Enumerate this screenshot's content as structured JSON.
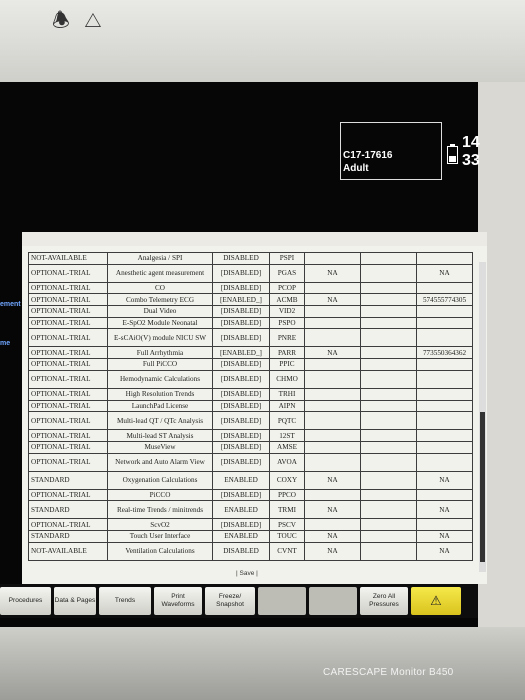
{
  "device": {
    "model": "CARESCAPE Monitor B450",
    "top_icons": [
      "alarm-audio-icon",
      "warning-triangle-icon"
    ]
  },
  "header": {
    "patient_id": "C17-17616",
    "patient_type": "Adult",
    "time": "14 33",
    "battery_level": 0.45
  },
  "side_labels": {
    "a": "ement",
    "b": "me"
  },
  "license_table": {
    "rows": [
      {
        "status": "NOT-AVAILABLE",
        "name": "Analgesia / SPI",
        "state": "DISABLED",
        "code": "PSPI",
        "s1": "",
        "s2": "",
        "s3": ""
      },
      {
        "status": "OPTIONAL-TRIAL",
        "name": "Anesthetic agent measurement",
        "state": "[DISABLED]",
        "code": "PGAS",
        "s1": "NA",
        "s2": "",
        "s3": "NA"
      },
      {
        "status": "OPTIONAL-TRIAL",
        "name": "CO",
        "state": "[DISABLED]",
        "code": "PCOP",
        "s1": "",
        "s2": "",
        "s3": ""
      },
      {
        "status": "OPTIONAL-TRIAL",
        "name": "Combo Telemetry ECG",
        "state": "[ENABLED_]",
        "code": "ACMB",
        "s1": "NA",
        "s2": "",
        "s3": "574555774305"
      },
      {
        "status": "OPTIONAL-TRIAL",
        "name": "Dual Video",
        "state": "[DISABLED]",
        "code": "VID2",
        "s1": "",
        "s2": "",
        "s3": ""
      },
      {
        "status": "OPTIONAL-TRIAL",
        "name": "E-SpO2 Module Neonatal",
        "state": "[DISABLED]",
        "code": "PSPO",
        "s1": "",
        "s2": "",
        "s3": ""
      },
      {
        "status": "OPTIONAL-TRIAL",
        "name": "E-sCAiO(V) module NICU SW",
        "state": "[DISABLED]",
        "code": "PNRE",
        "s1": "",
        "s2": "",
        "s3": ""
      },
      {
        "status": "OPTIONAL-TRIAL",
        "name": "Full Arrhythmia",
        "state": "[ENABLED_]",
        "code": "PARR",
        "s1": "NA",
        "s2": "",
        "s3": "773550364362"
      },
      {
        "status": "OPTIONAL-TRIAL",
        "name": "Full PiCCO",
        "state": "[DISABLED]",
        "code": "PPIC",
        "s1": "",
        "s2": "",
        "s3": ""
      },
      {
        "status": "OPTIONAL-TRIAL",
        "name": "Hemodynamic Calculations",
        "state": "[DISABLED]",
        "code": "CHMO",
        "s1": "",
        "s2": "",
        "s3": ""
      },
      {
        "status": "OPTIONAL-TRIAL",
        "name": "High Resolution Trends",
        "state": "[DISABLED]",
        "code": "TRHI",
        "s1": "",
        "s2": "",
        "s3": ""
      },
      {
        "status": "OPTIONAL-TRIAL",
        "name": "LaunchPad License",
        "state": "[DISABLED]",
        "code": "AIPN",
        "s1": "",
        "s2": "",
        "s3": ""
      },
      {
        "status": "OPTIONAL-TRIAL",
        "name": "Multi-lead QT / QTc Analysis",
        "state": "[DISABLED]",
        "code": "PQTC",
        "s1": "",
        "s2": "",
        "s3": ""
      },
      {
        "status": "OPTIONAL-TRIAL",
        "name": "Multi-lead ST Analysis",
        "state": "[DISABLED]",
        "code": "12ST",
        "s1": "",
        "s2": "",
        "s3": ""
      },
      {
        "status": "OPTIONAL-TRIAL",
        "name": "MuseView",
        "state": "[DISABLED]",
        "code": "AMSE",
        "s1": "",
        "s2": "",
        "s3": ""
      },
      {
        "status": "OPTIONAL-TRIAL",
        "name": "Network and Auto Alarm View",
        "state": "[DISABLED]",
        "code": "AVOA",
        "s1": "",
        "s2": "",
        "s3": ""
      },
      {
        "status": "STANDARD",
        "name": "Oxygenation Calculations",
        "state": "ENABLED",
        "code": "COXY",
        "s1": "NA",
        "s2": "",
        "s3": "NA"
      },
      {
        "status": "OPTIONAL-TRIAL",
        "name": "PiCCO",
        "state": "[DISABLED]",
        "code": "PPCO",
        "s1": "",
        "s2": "",
        "s3": ""
      },
      {
        "status": "STANDARD",
        "name": "Real-time Trends / minitrends",
        "state": "ENABLED",
        "code": "TRMI",
        "s1": "NA",
        "s2": "",
        "s3": "NA"
      },
      {
        "status": "OPTIONAL-TRIAL",
        "name": "ScvO2",
        "state": "[DISABLED]",
        "code": "PSCV",
        "s1": "",
        "s2": "",
        "s3": ""
      },
      {
        "status": "STANDARD",
        "name": "Touch User Interface",
        "state": "ENABLED",
        "code": "TOUC",
        "s1": "NA",
        "s2": "",
        "s3": "NA"
      },
      {
        "status": "NOT-AVAILABLE",
        "name": "Ventilation Calculations",
        "state": "DISABLED",
        "code": "CVNT",
        "s1": "NA",
        "s2": "",
        "s3": "NA"
      }
    ],
    "save_label": "| Save |"
  },
  "toolbar": {
    "procedures": "Procedures",
    "data_pages": "Data & Pages",
    "trends": "Trends",
    "print_waveforms": "Print Waveforms",
    "freeze_snapshot": "Freeze/ Snapshot",
    "zero_all": "Zero All Pressures",
    "alarm_icon": "alarm-silence-icon"
  }
}
